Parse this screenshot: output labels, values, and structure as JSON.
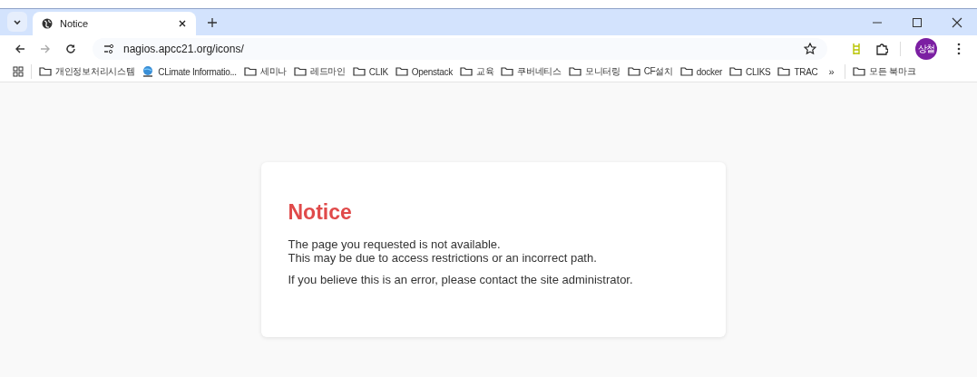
{
  "tabs": [
    {
      "label": "Notice",
      "selected": true
    }
  ],
  "address": {
    "url": "nagios.apcc21.org/icons/"
  },
  "profile": {
    "initials": "상철"
  },
  "bookmarks": [
    {
      "label": "개인정보처리시스템",
      "kind": "folder"
    },
    {
      "label": "CLimate Informatio...",
      "kind": "site"
    },
    {
      "label": "세미나",
      "kind": "folder"
    },
    {
      "label": "레드마인",
      "kind": "folder"
    },
    {
      "label": "CLIK",
      "kind": "folder"
    },
    {
      "label": "Openstack",
      "kind": "folder"
    },
    {
      "label": "교육",
      "kind": "folder"
    },
    {
      "label": "쿠버네티스",
      "kind": "folder"
    },
    {
      "label": "모니터링",
      "kind": "folder"
    },
    {
      "label": "CF설치",
      "kind": "folder"
    },
    {
      "label": "docker",
      "kind": "folder"
    },
    {
      "label": "CLIKS",
      "kind": "folder"
    },
    {
      "label": "TRAC",
      "kind": "folder"
    }
  ],
  "overflow": "»",
  "all_bookmarks": {
    "label": "모든 북마크"
  },
  "notice": {
    "title": "Notice",
    "paragraphs": [
      "The page you requested is not available.\nThis may be due to access restrictions or an incorrect path.",
      "If you believe this is an error, please contact the site administrator."
    ]
  }
}
